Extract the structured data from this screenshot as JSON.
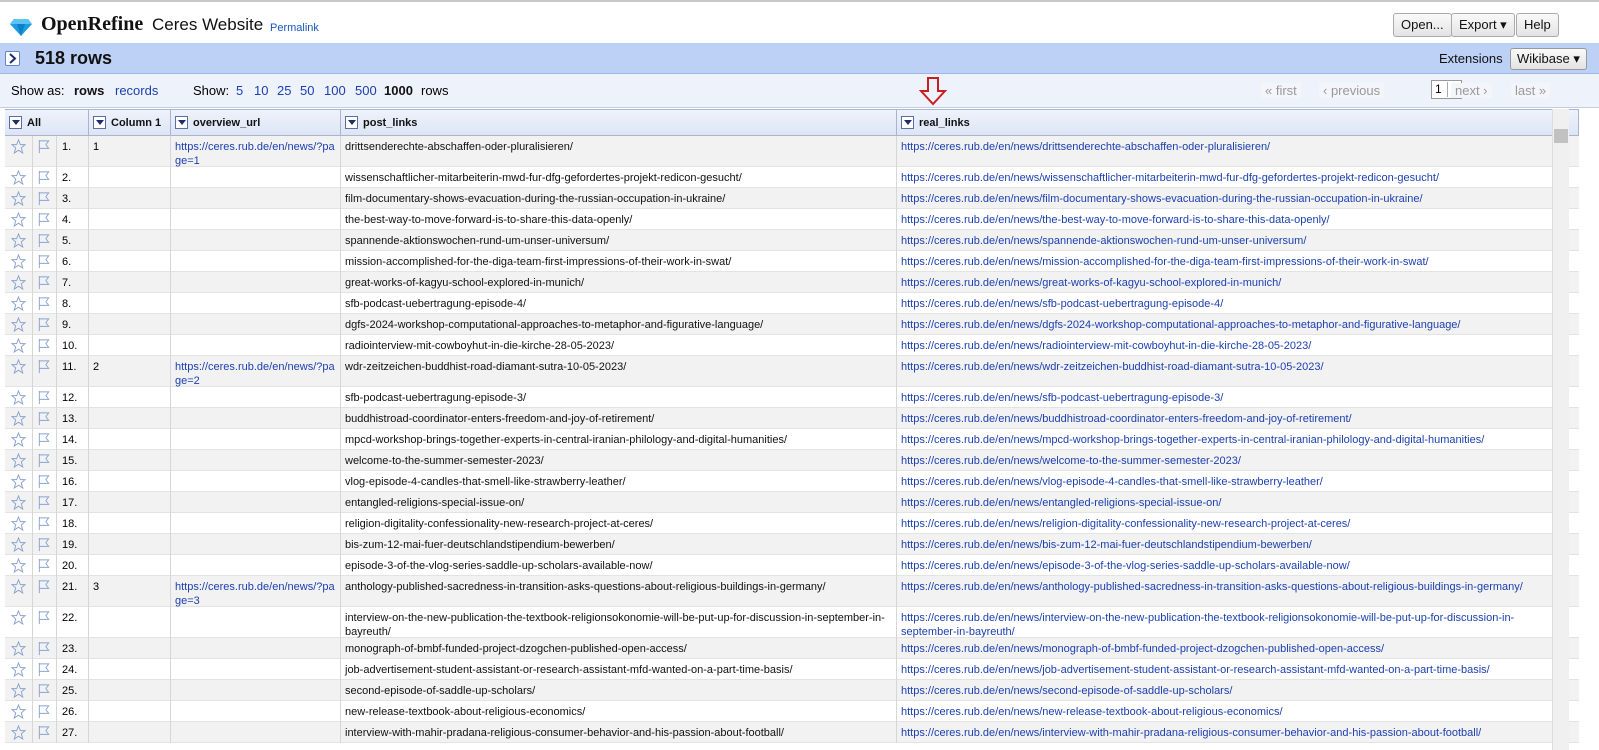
{
  "header": {
    "app_name": "OpenRefine",
    "project_name": "Ceres Website",
    "permalink": "Permalink",
    "open_btn": "Open...",
    "export_btn": "Export ▾",
    "help_btn": "Help"
  },
  "summary": {
    "row_count": "518 rows",
    "extensions_label": "Extensions",
    "wikibase_btn": "Wikibase ▾"
  },
  "viewbar": {
    "show_as": "Show as:",
    "rows": "rows",
    "records": "records",
    "show": "Show:",
    "sizes": [
      "5",
      "10",
      "25",
      "50",
      "100",
      "500",
      "1000"
    ],
    "rows_suffix": "rows",
    "first": "« first",
    "previous": "‹ previous",
    "page": "1",
    "next": "next ›",
    "last": "last »"
  },
  "columns": {
    "all": "All",
    "column1": "Column 1",
    "overview_url": "overview_url",
    "post_links": "post_links",
    "real_links": "real_links"
  },
  "rows": [
    {
      "n": "1.",
      "c1": "1",
      "ov": "https://ceres.rub.de/en/news/?page=1",
      "post": "drittsenderechte-abschaffen-oder-pluralisieren/",
      "real": "https://ceres.rub.de/en/news/drittsenderechte-abschaffen-oder-pluralisieren/"
    },
    {
      "n": "2.",
      "c1": "",
      "ov": "",
      "post": "wissenschaftlicher-mitarbeiterin-mwd-fur-dfg-gefordertes-projekt-redicon-gesucht/",
      "real": "https://ceres.rub.de/en/news/wissenschaftlicher-mitarbeiterin-mwd-fur-dfg-gefordertes-projekt-redicon-gesucht/"
    },
    {
      "n": "3.",
      "c1": "",
      "ov": "",
      "post": "film-documentary-shows-evacuation-during-the-russian-occupation-in-ukraine/",
      "real": "https://ceres.rub.de/en/news/film-documentary-shows-evacuation-during-the-russian-occupation-in-ukraine/"
    },
    {
      "n": "4.",
      "c1": "",
      "ov": "",
      "post": "the-best-way-to-move-forward-is-to-share-this-data-openly/",
      "real": "https://ceres.rub.de/en/news/the-best-way-to-move-forward-is-to-share-this-data-openly/"
    },
    {
      "n": "5.",
      "c1": "",
      "ov": "",
      "post": "spannende-aktionswochen-rund-um-unser-universum/",
      "real": "https://ceres.rub.de/en/news/spannende-aktionswochen-rund-um-unser-universum/"
    },
    {
      "n": "6.",
      "c1": "",
      "ov": "",
      "post": "mission-accomplished-for-the-diga-team-first-impressions-of-their-work-in-swat/",
      "real": "https://ceres.rub.de/en/news/mission-accomplished-for-the-diga-team-first-impressions-of-their-work-in-swat/"
    },
    {
      "n": "7.",
      "c1": "",
      "ov": "",
      "post": "great-works-of-kagyu-school-explored-in-munich/",
      "real": "https://ceres.rub.de/en/news/great-works-of-kagyu-school-explored-in-munich/"
    },
    {
      "n": "8.",
      "c1": "",
      "ov": "",
      "post": "sfb-podcast-uebertragung-episode-4/",
      "real": "https://ceres.rub.de/en/news/sfb-podcast-uebertragung-episode-4/"
    },
    {
      "n": "9.",
      "c1": "",
      "ov": "",
      "post": "dgfs-2024-workshop-computational-approaches-to-metaphor-and-figurative-language/",
      "real": "https://ceres.rub.de/en/news/dgfs-2024-workshop-computational-approaches-to-metaphor-and-figurative-language/"
    },
    {
      "n": "10.",
      "c1": "",
      "ov": "",
      "post": "radiointerview-mit-cowboyhut-in-die-kirche-28-05-2023/",
      "real": "https://ceres.rub.de/en/news/radiointerview-mit-cowboyhut-in-die-kirche-28-05-2023/"
    },
    {
      "n": "11.",
      "c1": "2",
      "ov": "https://ceres.rub.de/en/news/?page=2",
      "post": "wdr-zeitzeichen-buddhist-road-diamant-sutra-10-05-2023/",
      "real": "https://ceres.rub.de/en/news/wdr-zeitzeichen-buddhist-road-diamant-sutra-10-05-2023/"
    },
    {
      "n": "12.",
      "c1": "",
      "ov": "",
      "post": "sfb-podcast-uebertragung-episode-3/",
      "real": "https://ceres.rub.de/en/news/sfb-podcast-uebertragung-episode-3/"
    },
    {
      "n": "13.",
      "c1": "",
      "ov": "",
      "post": "buddhistroad-coordinator-enters-freedom-and-joy-of-retirement/",
      "real": "https://ceres.rub.de/en/news/buddhistroad-coordinator-enters-freedom-and-joy-of-retirement/"
    },
    {
      "n": "14.",
      "c1": "",
      "ov": "",
      "post": "mpcd-workshop-brings-together-experts-in-central-iranian-philology-and-digital-humanities/",
      "real": "https://ceres.rub.de/en/news/mpcd-workshop-brings-together-experts-in-central-iranian-philology-and-digital-humanities/"
    },
    {
      "n": "15.",
      "c1": "",
      "ov": "",
      "post": "welcome-to-the-summer-semester-2023/",
      "real": "https://ceres.rub.de/en/news/welcome-to-the-summer-semester-2023/"
    },
    {
      "n": "16.",
      "c1": "",
      "ov": "",
      "post": "vlog-episode-4-candles-that-smell-like-strawberry-leather/",
      "real": "https://ceres.rub.de/en/news/vlog-episode-4-candles-that-smell-like-strawberry-leather/"
    },
    {
      "n": "17.",
      "c1": "",
      "ov": "",
      "post": "entangled-religions-special-issue-on/",
      "real": "https://ceres.rub.de/en/news/entangled-religions-special-issue-on/"
    },
    {
      "n": "18.",
      "c1": "",
      "ov": "",
      "post": "religion-digitality-confessionality-new-research-project-at-ceres/",
      "real": "https://ceres.rub.de/en/news/religion-digitality-confessionality-new-research-project-at-ceres/"
    },
    {
      "n": "19.",
      "c1": "",
      "ov": "",
      "post": "bis-zum-12-mai-fuer-deutschlandstipendium-bewerben/",
      "real": "https://ceres.rub.de/en/news/bis-zum-12-mai-fuer-deutschlandstipendium-bewerben/"
    },
    {
      "n": "20.",
      "c1": "",
      "ov": "",
      "post": "episode-3-of-the-vlog-series-saddle-up-scholars-available-now/",
      "real": "https://ceres.rub.de/en/news/episode-3-of-the-vlog-series-saddle-up-scholars-available-now/"
    },
    {
      "n": "21.",
      "c1": "3",
      "ov": "https://ceres.rub.de/en/news/?page=3",
      "post": "anthology-published-sacredness-in-transition-asks-questions-about-religious-buildings-in-germany/",
      "real": "https://ceres.rub.de/en/news/anthology-published-sacredness-in-transition-asks-questions-about-religious-buildings-in-germany/"
    },
    {
      "n": "22.",
      "c1": "",
      "ov": "",
      "post": "interview-on-the-new-publication-the-textbook-religionsokonomie-will-be-put-up-for-discussion-in-september-in-bayreuth/",
      "real": "https://ceres.rub.de/en/news/interview-on-the-new-publication-the-textbook-religionsokonomie-will-be-put-up-for-discussion-in-september-in-bayreuth/"
    },
    {
      "n": "23.",
      "c1": "",
      "ov": "",
      "post": "monograph-of-bmbf-funded-project-dzogchen-published-open-access/",
      "real": "https://ceres.rub.de/en/news/monograph-of-bmbf-funded-project-dzogchen-published-open-access/"
    },
    {
      "n": "24.",
      "c1": "",
      "ov": "",
      "post": "job-advertisement-student-assistant-or-research-assistant-mfd-wanted-on-a-part-time-basis/",
      "real": "https://ceres.rub.de/en/news/job-advertisement-student-assistant-or-research-assistant-mfd-wanted-on-a-part-time-basis/"
    },
    {
      "n": "25.",
      "c1": "",
      "ov": "",
      "post": "second-episode-of-saddle-up-scholars/",
      "real": "https://ceres.rub.de/en/news/second-episode-of-saddle-up-scholars/"
    },
    {
      "n": "26.",
      "c1": "",
      "ov": "",
      "post": "new-release-textbook-about-religious-economics/",
      "real": "https://ceres.rub.de/en/news/new-release-textbook-about-religious-economics/"
    },
    {
      "n": "27.",
      "c1": "",
      "ov": "",
      "post": "interview-with-mahir-pradana-religious-consumer-behavior-and-his-passion-about-football/",
      "real": "https://ceres.rub.de/en/news/interview-with-mahir-pradana-religious-consumer-behavior-and-his-passion-about-football/"
    }
  ]
}
